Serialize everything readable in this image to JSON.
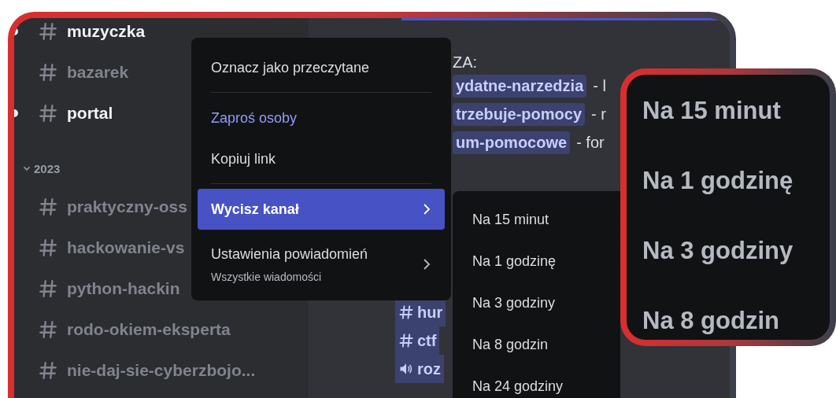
{
  "sidebar": {
    "items": [
      {
        "kind": "channel",
        "name": "muzyczka",
        "unread": true
      },
      {
        "kind": "channel",
        "name": "bazarek",
        "unread": false
      },
      {
        "kind": "channel",
        "name": "portal",
        "unread": true
      },
      {
        "kind": "category",
        "label": "2023",
        "expanded": true,
        "children": [
          {
            "kind": "channel",
            "name": "praktyczny-oss",
            "unread": false
          },
          {
            "kind": "channel",
            "name": "hackowanie-vs",
            "unread": false
          },
          {
            "kind": "channel",
            "name": "python-hackin",
            "unread": false
          },
          {
            "kind": "channel",
            "name": "rodo-okiem-eksperta",
            "unread": false
          },
          {
            "kind": "channel",
            "name": "nie-daj-sie-cyberzbojo...",
            "unread": false
          }
        ]
      }
    ]
  },
  "main": {
    "heading": "ZA:",
    "mentions": [
      {
        "channel": "ydatne-narzedzia",
        "text": "- l"
      },
      {
        "channel": "trzebuje-pomocy",
        "text": "- r"
      },
      {
        "channel": "um-pomocowe",
        "text": "- for"
      }
    ],
    "channel_pills": [
      {
        "kind": "text",
        "label": "hur"
      },
      {
        "kind": "text",
        "label": "ctf"
      },
      {
        "kind": "voice",
        "label": "roz"
      }
    ]
  },
  "context_menu": {
    "items": [
      {
        "kind": "item",
        "label": "Oznacz jako przeczytane",
        "selected": false
      },
      {
        "kind": "divider"
      },
      {
        "kind": "accent",
        "label": "Zaproś osoby",
        "selected": false
      },
      {
        "kind": "item",
        "label": "Kopiuj link",
        "selected": false
      },
      {
        "kind": "divider"
      },
      {
        "kind": "submenu",
        "label": "Wycisz kanał",
        "selected": true
      },
      {
        "kind": "submenu",
        "label": "Ustawienia powiadomień",
        "subtitle": "Wszystkie wiadomości",
        "selected": false
      }
    ]
  },
  "submenu": {
    "items": [
      "Na 15 minut",
      "Na 1 godzinę",
      "Na 3 godziny",
      "Na 8 godzin",
      "Na 24 godziny"
    ]
  },
  "callout": {
    "items": [
      "Na 15 minut",
      "Na 1 godzinę",
      "Na 3 godziny",
      "Na 8 godzin"
    ]
  }
}
